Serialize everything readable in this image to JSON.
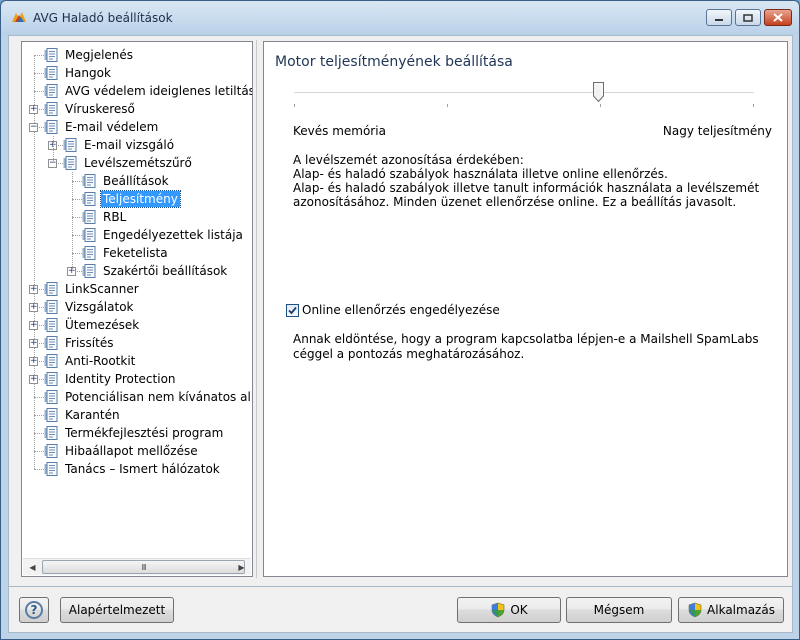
{
  "window": {
    "title": "AVG Haladó beállítások"
  },
  "tree": {
    "items": [
      {
        "label": "Megjelenés",
        "level": 0,
        "expander": ""
      },
      {
        "label": "Hangok",
        "level": 0,
        "expander": ""
      },
      {
        "label": "AVG védelem ideiglenes letiltása",
        "level": 0,
        "expander": ""
      },
      {
        "label": "Víruskereső",
        "level": 0,
        "expander": "+"
      },
      {
        "label": "E-mail védelem",
        "level": 0,
        "expander": "−"
      },
      {
        "label": "E-mail vizsgáló",
        "level": 1,
        "expander": "+"
      },
      {
        "label": "Levélszemétszűrő",
        "level": 1,
        "expander": "−"
      },
      {
        "label": "Beállítások",
        "level": 2,
        "expander": ""
      },
      {
        "label": "Teljesítmény",
        "level": 2,
        "expander": "",
        "selected": true
      },
      {
        "label": "RBL",
        "level": 2,
        "expander": ""
      },
      {
        "label": "Engedélyezettek listája",
        "level": 2,
        "expander": ""
      },
      {
        "label": "Feketelista",
        "level": 2,
        "expander": ""
      },
      {
        "label": "Szakértői beállítások",
        "level": 2,
        "expander": "+"
      },
      {
        "label": "LinkScanner",
        "level": 0,
        "expander": "+"
      },
      {
        "label": "Vizsgálatok",
        "level": 0,
        "expander": "+"
      },
      {
        "label": "Ütemezések",
        "level": 0,
        "expander": "+"
      },
      {
        "label": "Frissítés",
        "level": 0,
        "expander": "+"
      },
      {
        "label": "Anti-Rootkit",
        "level": 0,
        "expander": "+"
      },
      {
        "label": "Identity Protection",
        "level": 0,
        "expander": "+"
      },
      {
        "label": "Potenciálisan nem kívánatos alkalm",
        "level": 0,
        "expander": ""
      },
      {
        "label": "Karantén",
        "level": 0,
        "expander": ""
      },
      {
        "label": "Termékfejlesztési program",
        "level": 0,
        "expander": ""
      },
      {
        "label": "Hibaállapot mellőzése",
        "level": 0,
        "expander": ""
      },
      {
        "label": "Tanács – Ismert hálózatok",
        "level": 0,
        "expander": ""
      }
    ],
    "scroll_grip": "III"
  },
  "panel": {
    "title": "Motor teljesítményének beállítása",
    "slider_min_label": "Kevés memória",
    "slider_max_label": "Nagy teljesítmény",
    "slider_value_fraction": 0.66,
    "desc_line1": "A levélszemét azonosítása érdekében:",
    "desc_line2": "Alap- és haladó szabályok használata illetve online ellenőrzés.",
    "desc_line3": "Alap- és haladó szabályok illetve tanult információk használata a levélszemét azonosításához. Minden üzenet ellenőrzése online. Ez a beállítás javasolt.",
    "checkbox_label": "Online ellenőrzés engedélyezése",
    "checkbox_checked": true,
    "hint": "Annak eldöntése, hogy a program kapcsolatba lépjen-e a Mailshell SpamLabs céggel a pontozás meghatározásához."
  },
  "buttons": {
    "help": "?",
    "defaults": "Alapértelmezett",
    "ok": "OK",
    "cancel": "Mégsem",
    "apply": "Alkalmazás"
  },
  "colors": {
    "selection": "#3399ff",
    "title_text": "#1f3555"
  }
}
